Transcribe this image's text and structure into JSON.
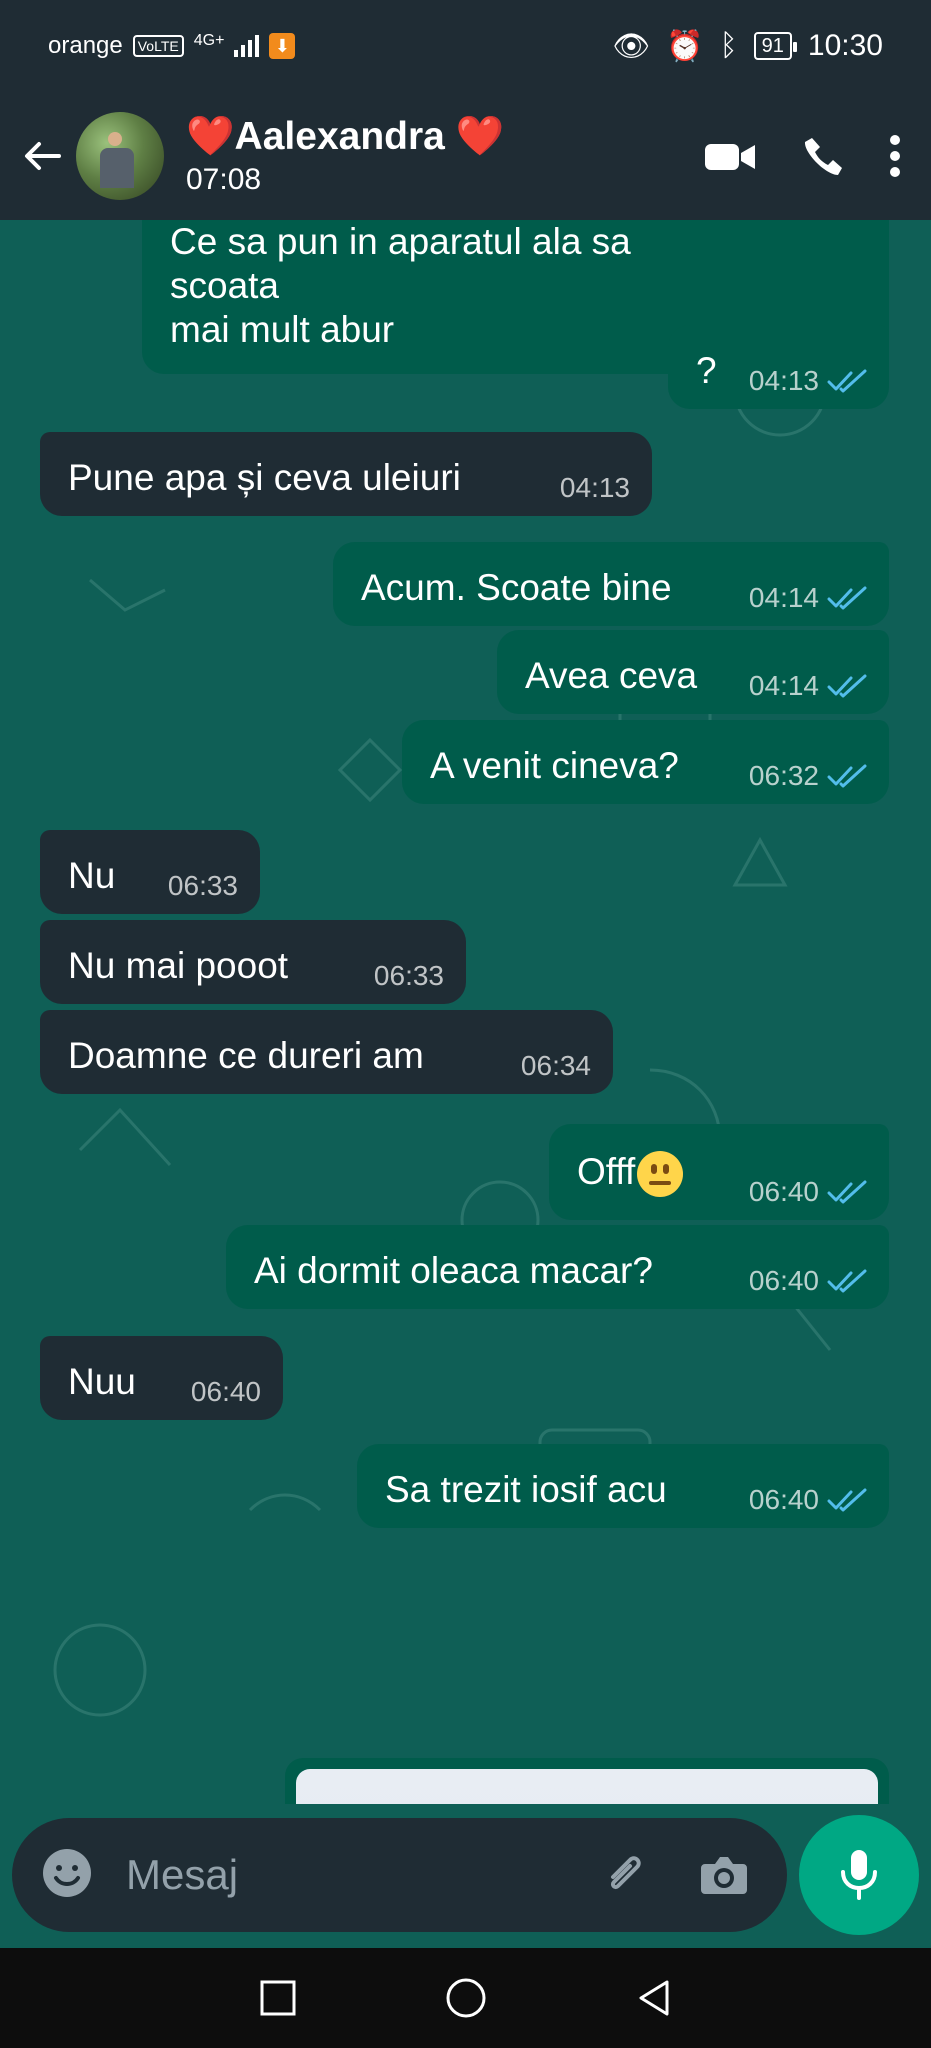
{
  "status_bar": {
    "carrier": "orange",
    "volte": "VoLTE",
    "network": "4G+",
    "battery": "91",
    "time": "10:30"
  },
  "header": {
    "name": "❤️Aalexandra ❤️",
    "last_seen": "07:08"
  },
  "messages": [
    {
      "direction": "out",
      "text": "Ce sa pun in aparatul ala sa scoata\nmai mult abur",
      "time": "04:13",
      "ticks": "read"
    },
    {
      "direction": "out",
      "text": "?",
      "time": "04:13",
      "ticks": "read"
    },
    {
      "direction": "in",
      "text": "Pune apa și ceva uleiuri",
      "time": "04:13"
    },
    {
      "direction": "out",
      "text": "Acum. Scoate bine",
      "time": "04:14",
      "ticks": "read"
    },
    {
      "direction": "out",
      "text": "Avea ceva",
      "time": "04:14",
      "ticks": "read"
    },
    {
      "direction": "out",
      "text": "A venit cineva?",
      "time": "06:32",
      "ticks": "read"
    },
    {
      "direction": "in",
      "text": "Nu",
      "time": "06:33"
    },
    {
      "direction": "in",
      "text": "Nu mai pooot",
      "time": "06:33"
    },
    {
      "direction": "in",
      "text": "Doamne ce dureri am",
      "time": "06:34"
    },
    {
      "direction": "out",
      "text": "Offf",
      "emoji": "neutral-face",
      "time": "06:40",
      "ticks": "read"
    },
    {
      "direction": "out",
      "text": "Ai dormit oleaca macar?",
      "time": "06:40",
      "ticks": "read"
    },
    {
      "direction": "in",
      "text": "Nuu",
      "time": "06:40"
    },
    {
      "direction": "out",
      "text": "Sa trezit iosif acu",
      "time": "06:40",
      "ticks": "read"
    }
  ],
  "composer": {
    "placeholder": "Mesaj"
  },
  "colors": {
    "chat_background": "#0f5f56",
    "outgoing_bubble": "#005c4b",
    "incoming_bubble": "#1f2c34",
    "header": "#1f2c34",
    "mic_button": "#00a884",
    "read_ticks": "#53bdeb"
  },
  "icons": {
    "back": "back-arrow-icon",
    "video": "video-call-icon",
    "call": "phone-icon",
    "menu": "more-vertical-icon",
    "emoji": "emoji-icon",
    "attach": "paperclip-icon",
    "camera": "camera-icon",
    "mic": "microphone-icon",
    "scroll": "double-chevron-down-icon"
  }
}
